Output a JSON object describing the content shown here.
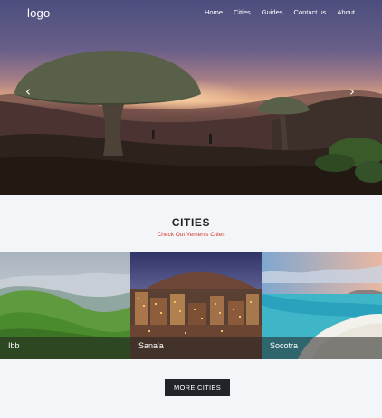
{
  "header": {
    "logo": "logo",
    "nav": [
      "Home",
      "Cities",
      "Guides",
      "Contact us",
      "About"
    ]
  },
  "hero": {
    "prev_arrow": "‹",
    "next_arrow": "›"
  },
  "cities": {
    "title": "CITIES",
    "subtitle": "Check Out Yemen's Cities",
    "items": [
      {
        "name": "Ibb"
      },
      {
        "name": "Sana'a"
      },
      {
        "name": "Socotra"
      }
    ],
    "more_button": "MORE CITIES"
  },
  "colors": {
    "accent_subtitle": "#d23a2a",
    "button_bg": "#22242a",
    "section_bg": "#f4f5f8"
  }
}
